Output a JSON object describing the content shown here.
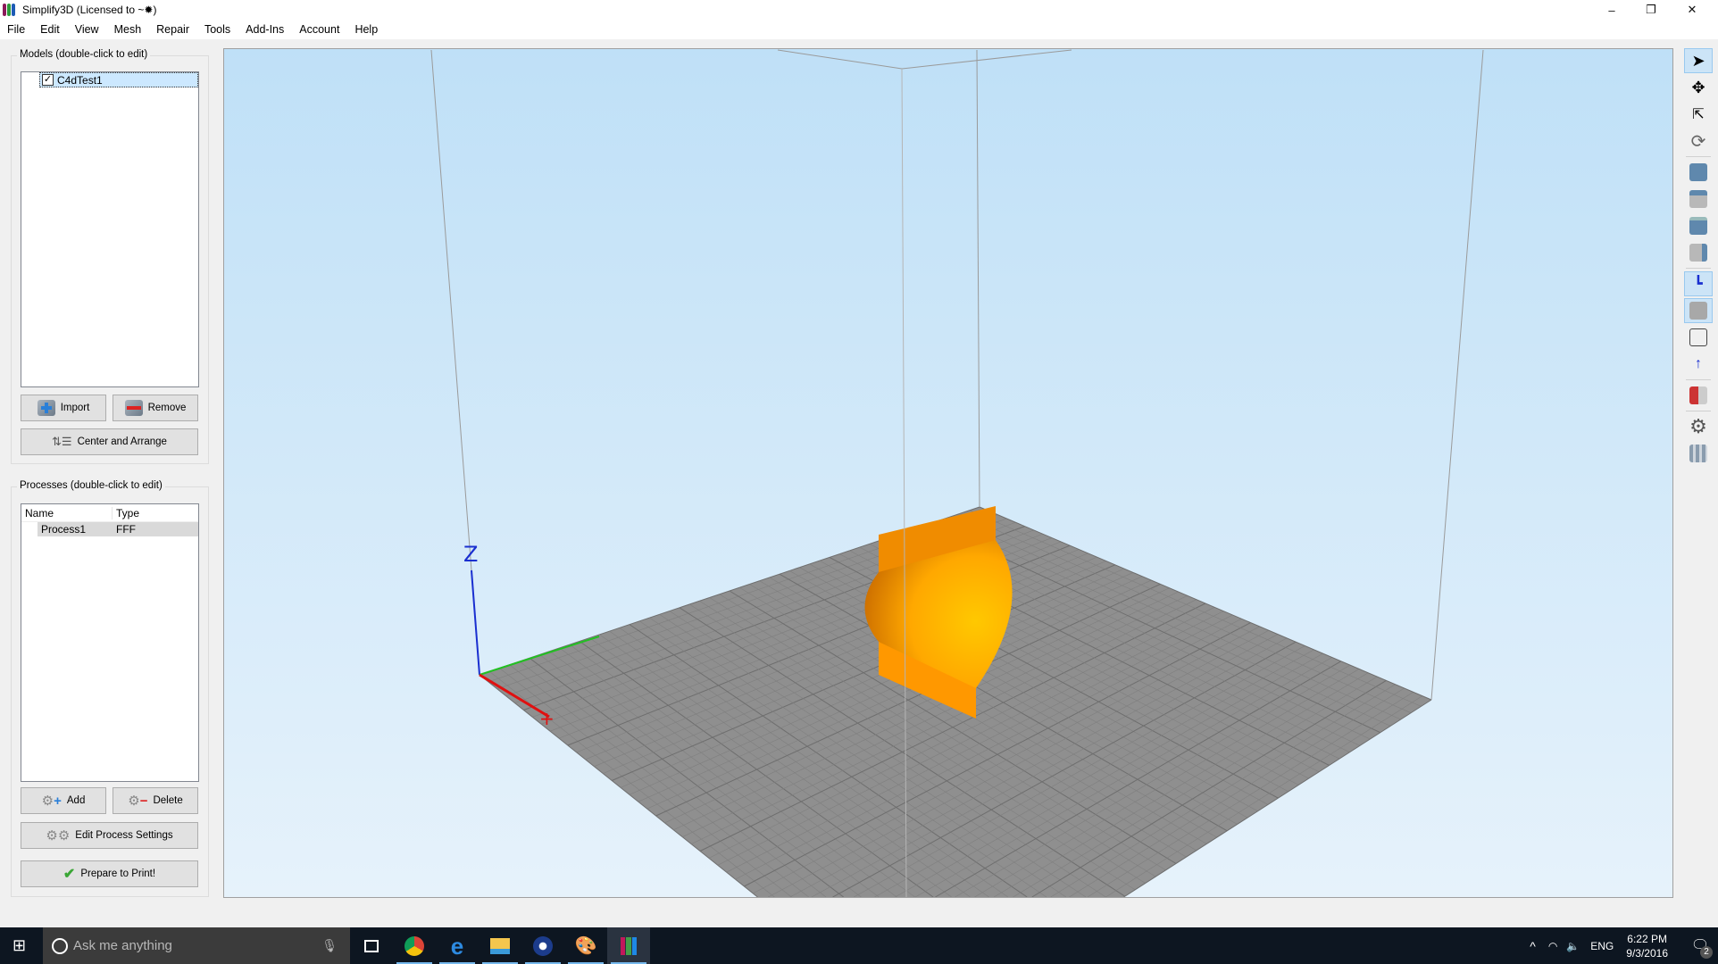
{
  "window": {
    "title": "Simplify3D (Licensed to ~✹)",
    "minimize": "–",
    "restore": "❐",
    "close": "✕"
  },
  "menu": [
    "File",
    "Edit",
    "View",
    "Mesh",
    "Repair",
    "Tools",
    "Add-Ins",
    "Account",
    "Help"
  ],
  "models": {
    "group_label": "Models (double-click to edit)",
    "items": [
      {
        "name": "C4dTest1",
        "checked": true
      }
    ],
    "import_label": "Import",
    "remove_label": "Remove",
    "center_label": "Center and Arrange"
  },
  "processes": {
    "group_label": "Processes (double-click to edit)",
    "columns": [
      "Name",
      "Type"
    ],
    "rows": [
      {
        "name": "Process1",
        "type": "FFF"
      }
    ],
    "add_label": "Add",
    "delete_label": "Delete",
    "edit_label": "Edit Process Settings",
    "prepare_label": "Prepare to Print!"
  },
  "viewport": {
    "axis_z_label": "Z",
    "model_color": "#ffa000",
    "bed_color": "#8f8f8f"
  },
  "toolbar": [
    "select-icon",
    "move-icon",
    "scale-icon",
    "rotate-icon",
    "view-default-icon",
    "view-top-icon",
    "view-front-icon",
    "view-side-icon",
    "axes-icon",
    "solid-view-icon",
    "wireframe-view-icon",
    "normals-icon",
    "cross-section-icon",
    "settings-icon",
    "machine-icon"
  ],
  "taskbar": {
    "search_placeholder": "Ask me anything",
    "apps": [
      "task-view-icon",
      "chrome-icon",
      "edge-icon",
      "file-explorer-icon",
      "cinema4d-icon",
      "paint-icon",
      "simplify3d-icon"
    ],
    "language": "ENG",
    "time": "6:22 PM",
    "date": "9/3/2016",
    "notifications": "2"
  }
}
